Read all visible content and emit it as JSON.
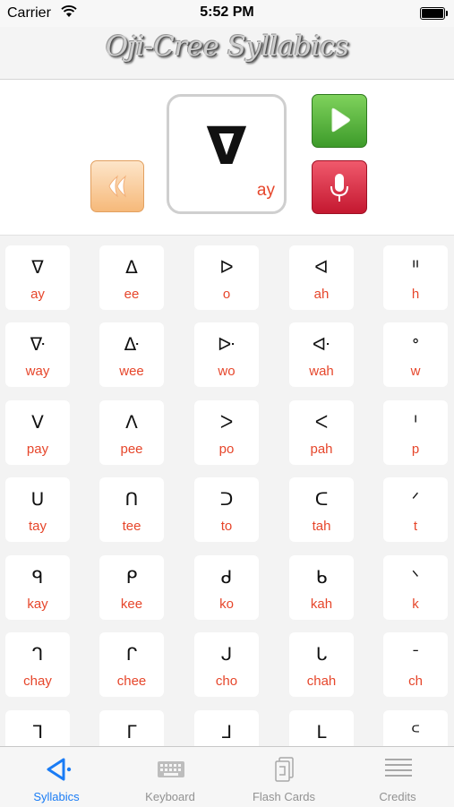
{
  "status_bar": {
    "carrier": "Carrier",
    "time": "5:52 PM"
  },
  "header": {
    "title": "Oji-Cree Syllabics"
  },
  "display": {
    "symbol": "ᐁ",
    "romanization": "ay"
  },
  "syllabics": [
    [
      {
        "s": "ᐁ",
        "r": "ay"
      },
      {
        "s": "ᐃ",
        "r": "ee"
      },
      {
        "s": "ᐅ",
        "r": "o"
      },
      {
        "s": "ᐊ",
        "r": "ah"
      },
      {
        "s": "ᐦ",
        "r": "h"
      }
    ],
    [
      {
        "s": "ᐍ",
        "r": "way"
      },
      {
        "s": "ᐏ",
        "r": "wee"
      },
      {
        "s": "ᐓ",
        "r": "wo"
      },
      {
        "s": "ᐘ",
        "r": "wah"
      },
      {
        "s": "ᐤ",
        "r": "w"
      }
    ],
    [
      {
        "s": "ᐯ",
        "r": "pay"
      },
      {
        "s": "ᐱ",
        "r": "pee"
      },
      {
        "s": "ᐳ",
        "r": "po"
      },
      {
        "s": "ᐸ",
        "r": "pah"
      },
      {
        "s": "ᑊ",
        "r": "p"
      }
    ],
    [
      {
        "s": "ᑌ",
        "r": "tay"
      },
      {
        "s": "ᑎ",
        "r": "tee"
      },
      {
        "s": "ᑐ",
        "r": "to"
      },
      {
        "s": "ᑕ",
        "r": "tah"
      },
      {
        "s": "ᐟ",
        "r": "t"
      }
    ],
    [
      {
        "s": "ᑫ",
        "r": "kay"
      },
      {
        "s": "ᑭ",
        "r": "kee"
      },
      {
        "s": "ᑯ",
        "r": "ko"
      },
      {
        "s": "ᑲ",
        "r": "kah"
      },
      {
        "s": "ᐠ",
        "r": "k"
      }
    ],
    [
      {
        "s": "ᒉ",
        "r": "chay"
      },
      {
        "s": "ᒋ",
        "r": "chee"
      },
      {
        "s": "ᒍ",
        "r": "cho"
      },
      {
        "s": "ᒐ",
        "r": "chah"
      },
      {
        "s": "ᐨ",
        "r": "ch"
      }
    ],
    [
      {
        "s": "ᒣ",
        "r": ""
      },
      {
        "s": "ᒥ",
        "r": ""
      },
      {
        "s": "ᒧ",
        "r": ""
      },
      {
        "s": "ᒪ",
        "r": ""
      },
      {
        "s": "ᒼ",
        "r": ""
      }
    ]
  ],
  "tabs": [
    {
      "label": "Syllabics",
      "icon": "syllabics-icon",
      "active": true
    },
    {
      "label": "Keyboard",
      "icon": "keyboard-icon",
      "active": false
    },
    {
      "label": "Flash Cards",
      "icon": "flash-cards-icon",
      "active": false
    },
    {
      "label": "Credits",
      "icon": "credits-icon",
      "active": false
    }
  ],
  "colors": {
    "romanization": "#e6462b",
    "active_tab": "#1a7cf5",
    "inactive_tab": "#929292",
    "play": "#4caf33",
    "mic": "#d62a40",
    "rewind": "#f6b97a"
  }
}
